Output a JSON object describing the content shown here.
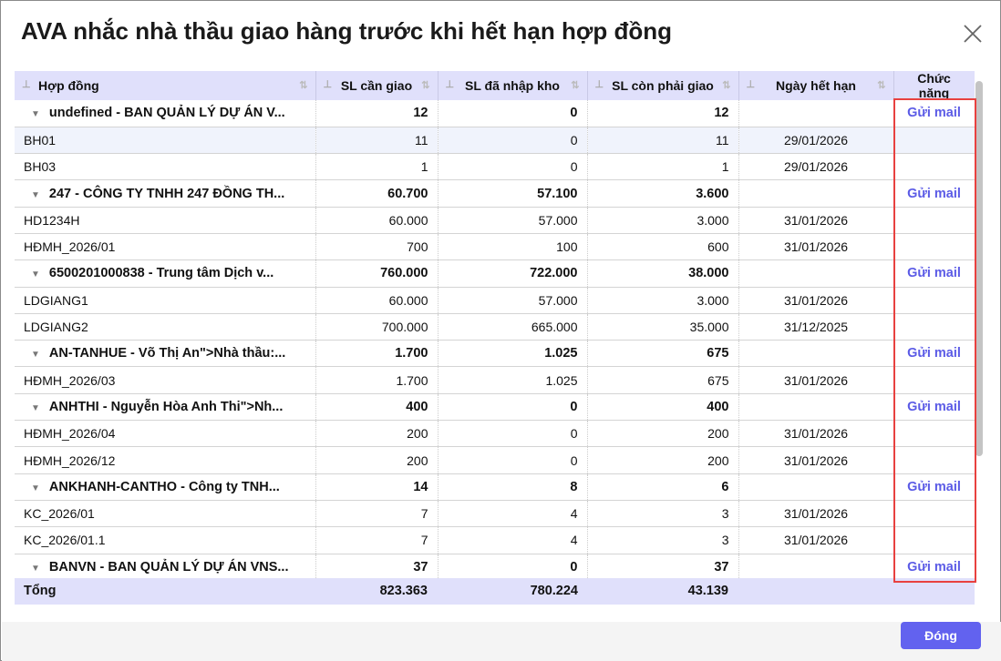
{
  "title": "AVA nhắc nhà thầu giao hàng trước khi hết hạn hợp đồng",
  "columns": [
    "Hợp đồng",
    "SL cần giao",
    "SL đã nhập kho",
    "SL còn phải giao",
    "Ngày hết hạn",
    "Chức năng"
  ],
  "action_label": "Gửi mail",
  "rows": [
    {
      "type": "group",
      "name": "undefined - BAN QUẢN LÝ DỰ ÁN V...",
      "need": "12",
      "received": "0",
      "remaining": "12"
    },
    {
      "type": "item",
      "name": "BH01",
      "need": "11",
      "received": "0",
      "remaining": "11",
      "date": "29/01/2026",
      "selected": true
    },
    {
      "type": "item",
      "name": "BH03",
      "need": "1",
      "received": "0",
      "remaining": "1",
      "date": "29/01/2026"
    },
    {
      "type": "group",
      "name": "247 - CÔNG TY TNHH 247 ĐỒNG TH...",
      "need": "60.700",
      "received": "57.100",
      "remaining": "3.600"
    },
    {
      "type": "item",
      "name": "HD1234H",
      "need": "60.000",
      "received": "57.000",
      "remaining": "3.000",
      "date": "31/01/2026"
    },
    {
      "type": "item",
      "name": "HĐMH_2026/01",
      "need": "700",
      "received": "100",
      "remaining": "600",
      "date": "31/01/2026"
    },
    {
      "type": "group",
      "name": "6500201000838 - Trung tâm Dịch v...",
      "need": "760.000",
      "received": "722.000",
      "remaining": "38.000"
    },
    {
      "type": "item",
      "name": "LDGIANG1",
      "need": "60.000",
      "received": "57.000",
      "remaining": "3.000",
      "date": "31/01/2026"
    },
    {
      "type": "item",
      "name": "LDGIANG2",
      "need": "700.000",
      "received": "665.000",
      "remaining": "35.000",
      "date": "31/12/2025"
    },
    {
      "type": "group",
      "name": "AN-TANHUE - Võ Thị An\">Nhà thầu:...",
      "need": "1.700",
      "received": "1.025",
      "remaining": "675"
    },
    {
      "type": "item",
      "name": "HĐMH_2026/03",
      "need": "1.700",
      "received": "1.025",
      "remaining": "675",
      "date": "31/01/2026"
    },
    {
      "type": "group",
      "name": "ANHTHI - Nguyễn Hòa Anh Thi\">Nh...",
      "need": "400",
      "received": "0",
      "remaining": "400"
    },
    {
      "type": "item",
      "name": "HĐMH_2026/04",
      "need": "200",
      "received": "0",
      "remaining": "200",
      "date": "31/01/2026"
    },
    {
      "type": "item",
      "name": "HĐMH_2026/12",
      "need": "200",
      "received": "0",
      "remaining": "200",
      "date": "31/01/2026"
    },
    {
      "type": "group",
      "name": "ANKHANH-CANTHO - Công ty TNH...",
      "need": "14",
      "received": "8",
      "remaining": "6"
    },
    {
      "type": "item",
      "name": "KC_2026/01",
      "need": "7",
      "received": "4",
      "remaining": "3",
      "date": "31/01/2026"
    },
    {
      "type": "item",
      "name": "KC_2026/01.1",
      "need": "7",
      "received": "4",
      "remaining": "3",
      "date": "31/01/2026"
    },
    {
      "type": "group",
      "name": "BANVN - BAN QUẢN LÝ DỰ ÁN VNS...",
      "need": "37",
      "received": "0",
      "remaining": "37"
    }
  ],
  "total": {
    "label": "Tổng",
    "need": "823.363",
    "received": "780.224",
    "remaining": "43.139"
  },
  "footer": {
    "close_label": "Đóng"
  }
}
